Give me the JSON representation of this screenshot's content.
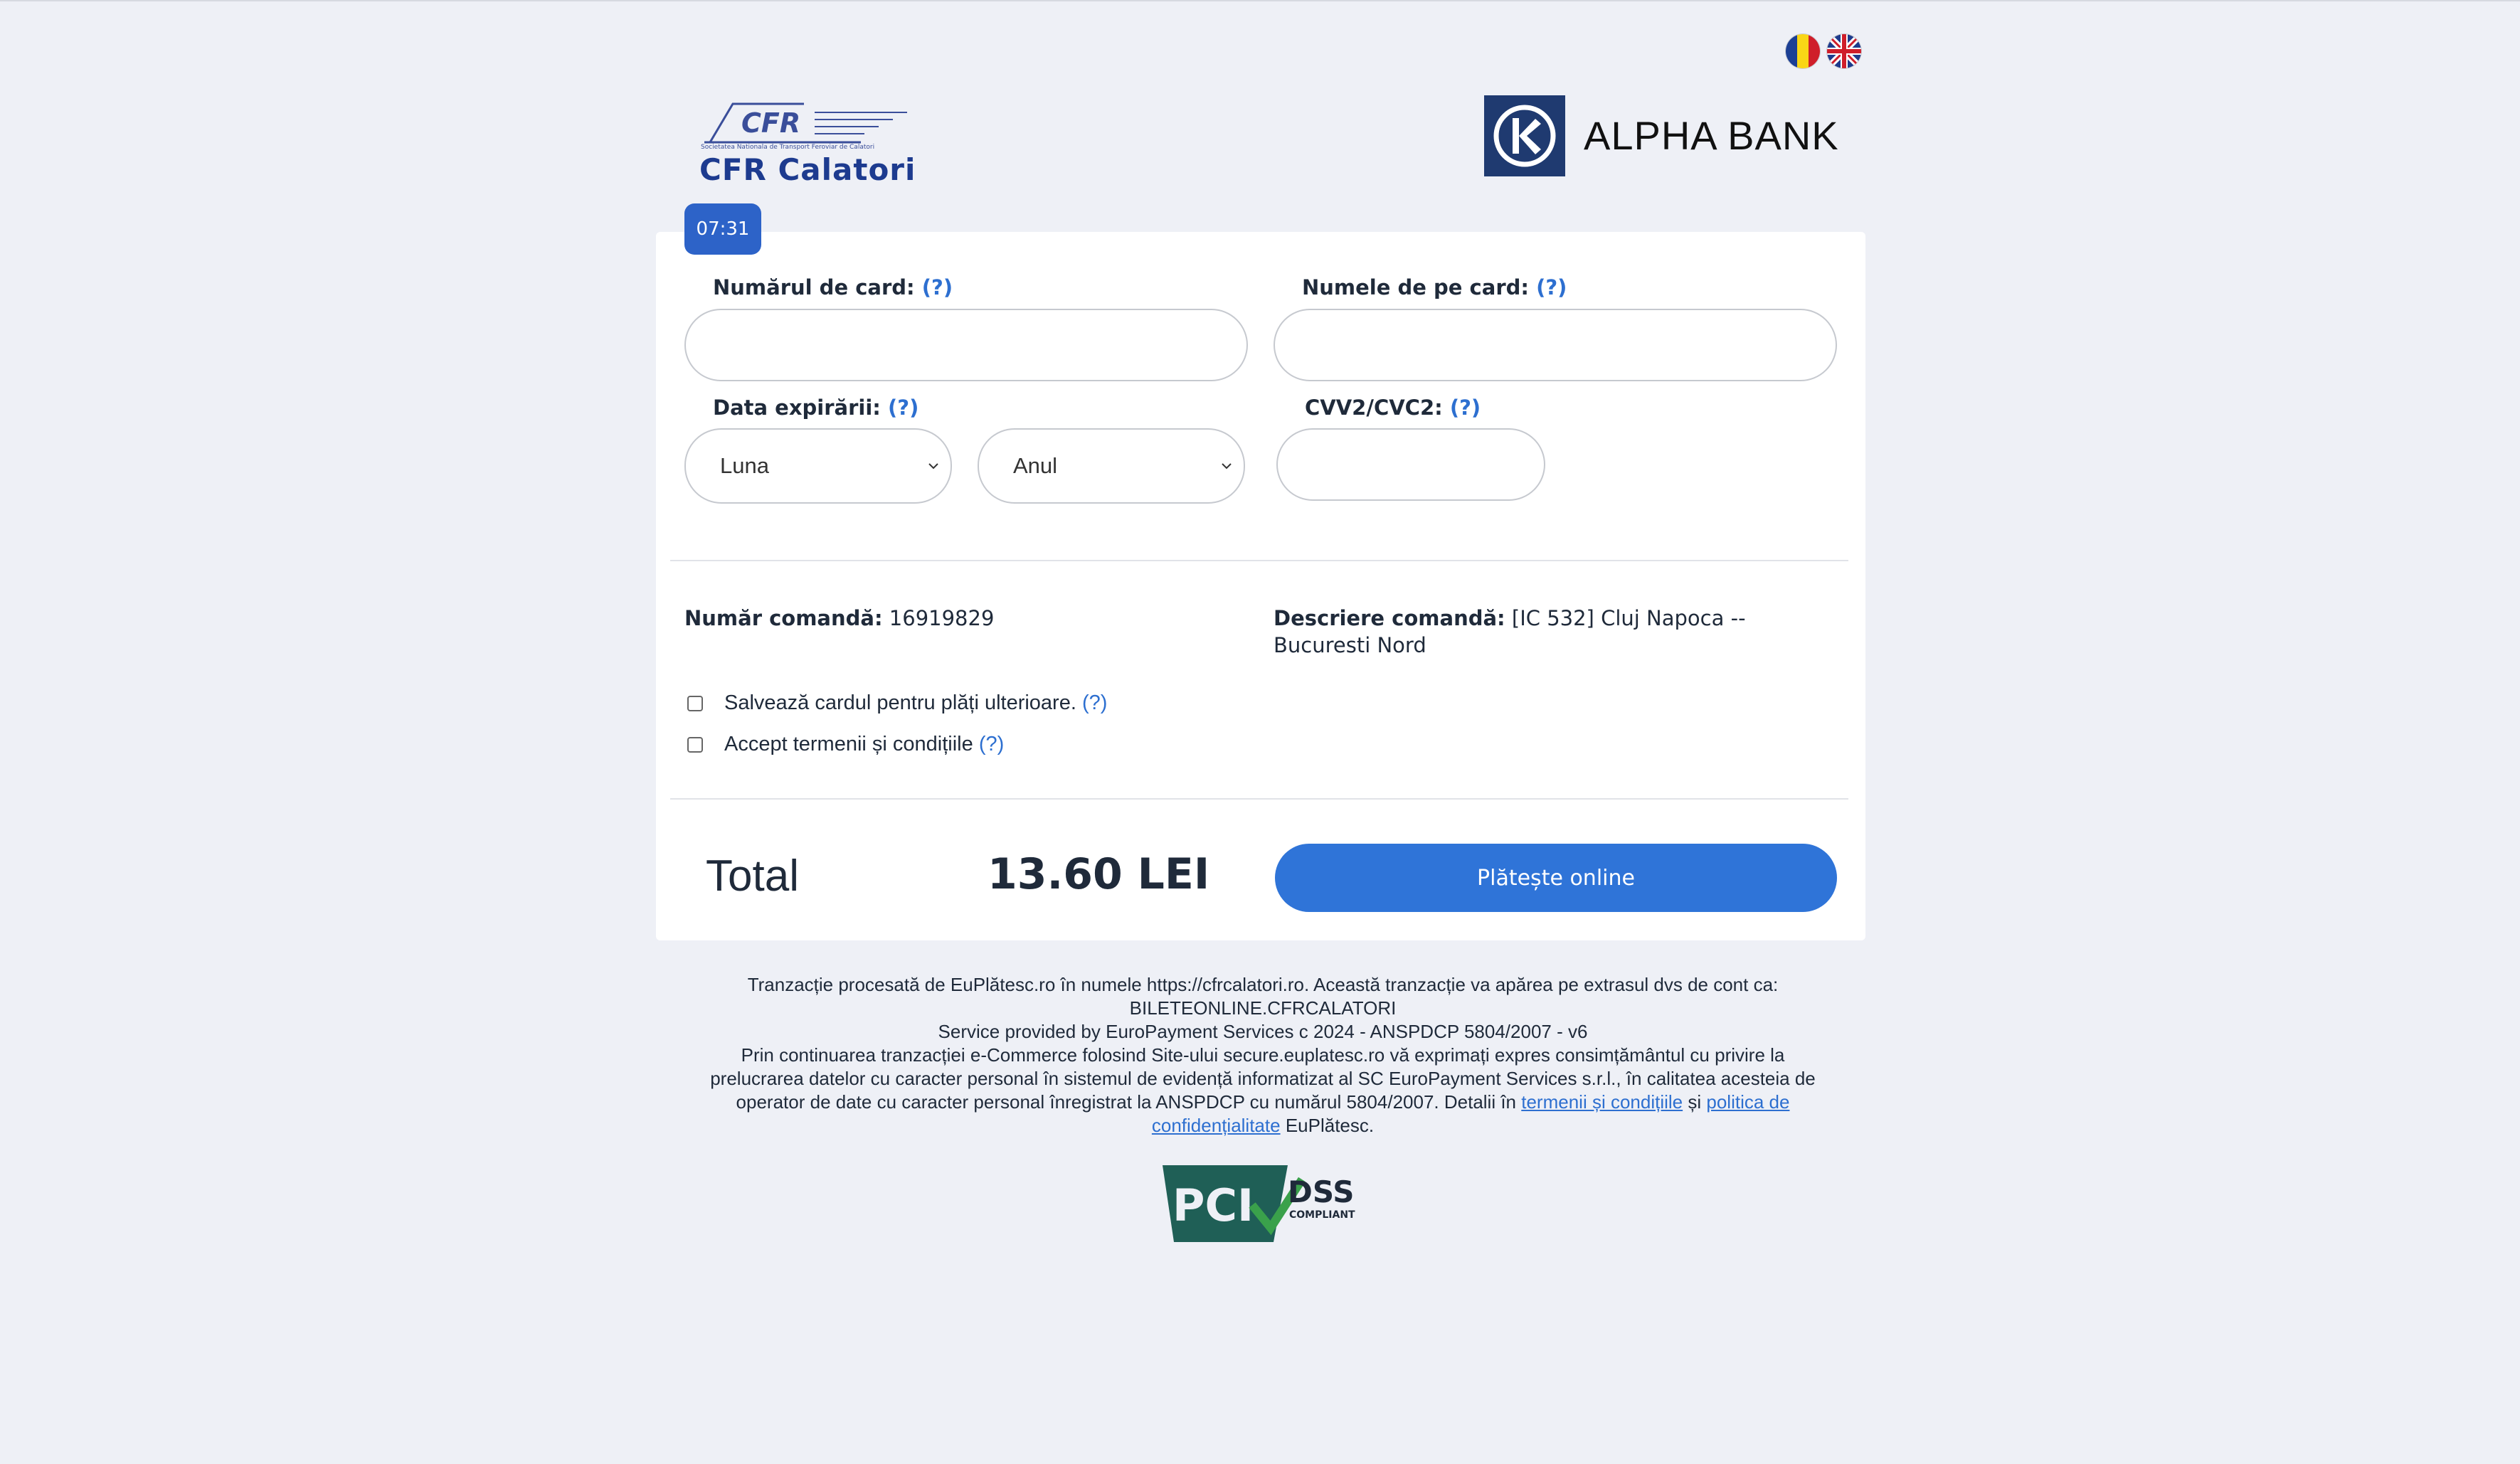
{
  "header": {
    "merchant_logo_title": "CFR Calatori",
    "merchant_logo_tag": "CFR",
    "merchant_logo_subtitle": "Societatea Nationala de Transport Feroviar de Calatori",
    "bank_name": "ALPHA BANK",
    "languages": [
      "ro-flag-icon",
      "en-flag-icon"
    ]
  },
  "timer": "07:31",
  "form": {
    "card_number_label": "Numărul de card:",
    "card_name_label": "Numele de pe card:",
    "expiry_label": "Data expirării:",
    "cvv_label": "CVV2/CVC2:",
    "help": "(?)",
    "month_select": "Luna",
    "year_select": "Anul"
  },
  "order": {
    "number_label": "Număr comandă:",
    "number_value": "16919829",
    "description_label": "Descriere comandă:",
    "description_value": "[IC 532] Cluj Napoca -- Bucuresti Nord"
  },
  "checkboxes": {
    "save_card": "Salvează cardul pentru plăți ulterioare.",
    "accept_terms": "Accept termenii și condițiile"
  },
  "total": {
    "label": "Total",
    "value": "13.60 LEI"
  },
  "pay_button": "Plătește online",
  "footer": {
    "line1": "Tranzacție procesată de EuPlătesc.ro în numele https://cfrcalatori.ro. Această tranzacție va apărea pe extrasul dvs de cont ca:",
    "line2": "BILETEONLINE.CFRCALATORI",
    "line3": "Service provided by EuroPayment Services c 2024 - ANSPDCP 5804/2007 - v6",
    "consent_text": "Prin continuarea tranzacției e-Commerce folosind Site-ului secure.euplatesc.ro vă exprimați expres consimțământul cu privire la prelucrarea datelor cu caracter personal în sistemul de evidență informatizat al SC EuroPayment Services s.r.l., în calitatea acesteia de operator de date cu caracter personal înregistrat la ANSPDCP cu numărul 5804/2007. Detalii în",
    "terms_link": "termenii și condițiile",
    "and": "și",
    "privacy_link": "politica de confidențialitate",
    "brand_suffix": "EuPlătesc."
  },
  "badge": {
    "pci_text": "PCI",
    "dss_text": "DSS",
    "compliant_text": "COMPLIANT"
  },
  "colors": {
    "page_bg": "#eef0f6",
    "accent": "#2f74d8",
    "timer": "#2d63c8",
    "bank_blue": "#1f3a70",
    "cfr_blue": "#1d3b8f"
  }
}
